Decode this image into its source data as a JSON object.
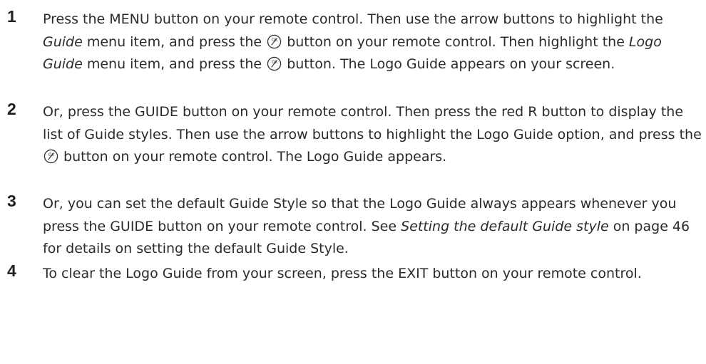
{
  "steps": [
    {
      "number": "1",
      "parts": {
        "p1": "Press the MENU button on your remote control. Then use the arrow buttons to highlight the ",
        "em1": "Guide",
        "p2": " menu item, and press the ",
        "p3": " button on your remote control. Then highlight the ",
        "em2": "Logo Guide",
        "p4": " menu item, and press the ",
        "p5": " button. The Logo Guide appears on your screen."
      }
    },
    {
      "number": "2",
      "parts": {
        "p1": "Or, press the GUIDE button on your remote control. Then press the red R button to display the list of Guide styles. Then use the arrow buttons to highlight the Logo Guide option, and press the ",
        "p2": " button on your remote control. The Logo Guide appears."
      }
    },
    {
      "number": "3",
      "parts": {
        "p1": "Or, you can set the default Guide Style so that the Logo Guide always appears whenever you press the GUIDE button on your remote control. See ",
        "em1": "Setting the default Guide style",
        "p2": " on page 46 for details on setting the default Guide Style."
      }
    },
    {
      "number": "4",
      "parts": {
        "p1": "To clear the Logo Guide from your screen, press the EXIT button on your remote control."
      }
    }
  ],
  "icons": {
    "ok_button": "ok-button-icon"
  }
}
